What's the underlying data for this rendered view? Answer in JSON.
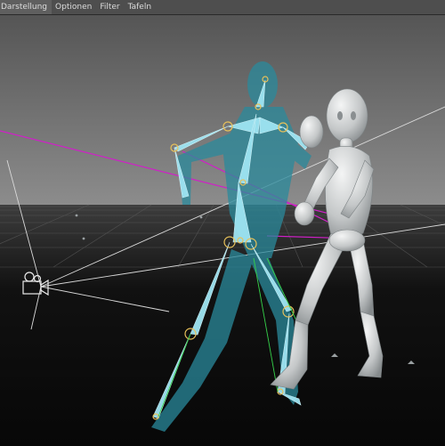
{
  "menubar": {
    "items": [
      {
        "label": "Darstellung"
      },
      {
        "label": "Optionen"
      },
      {
        "label": "Filter"
      },
      {
        "label": "Tafeln"
      }
    ]
  },
  "viewport": {
    "type": "3D perspective view",
    "objects": [
      {
        "name": "character-rig",
        "icon": "skeleton-joints",
        "color": "#8fd8ea"
      },
      {
        "name": "mannequin-figure",
        "color": "#d6d8d8"
      },
      {
        "name": "camera",
        "icon": "camera-icon"
      },
      {
        "name": "rig-line",
        "color": "#d020c8"
      }
    ],
    "colors": {
      "sky_top": "#5a5a5a",
      "sky_bottom": "#8a8a8a",
      "floor": "#0a0a0a",
      "grid": "#555555",
      "rig_highlight": "#8fd8ea",
      "rig_shadow": "#1e6e7e",
      "joint": "#e8c15a"
    }
  }
}
